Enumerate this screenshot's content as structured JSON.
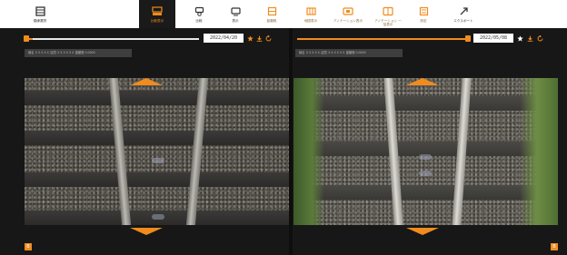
{
  "colors": {
    "accent": "#f08c1e",
    "toolbar_bg": "#ffffff",
    "viewer_bg": "#171717"
  },
  "toolbar": {
    "items": [
      {
        "label": "路線選択",
        "icon": "book-icon"
      },
      {
        "label": "比較表示",
        "icon": "compare-icon",
        "active": true
      },
      {
        "label": "比較",
        "icon": "camera-icon"
      },
      {
        "label": "表示",
        "icon": "monitor-icon"
      },
      {
        "label": "距離程",
        "icon": "frame-icon"
      },
      {
        "label": "地図表示",
        "icon": "map-icon"
      },
      {
        "label": "アノテーション表示",
        "icon": "annotation-icon"
      },
      {
        "label": "アノテーション 一括表示",
        "icon": "annotation-list-icon"
      },
      {
        "label": "設定",
        "icon": "settings-icon"
      },
      {
        "label": "エクスポート",
        "icon": "export-icon"
      }
    ]
  },
  "left_panel": {
    "date": "2022/04/20",
    "info_text": "線名 ＸＸＸＸＸ  区間 ＸＸＸＸＸＸ  距離程 0.0000",
    "corner_label": "B"
  },
  "right_panel": {
    "date": "2022/05/08",
    "info_text": "線名 ＸＸＸＸＸ  区間 ＸＸＸＸＸＸ  距離程 0.0000",
    "corner_label": "B"
  }
}
